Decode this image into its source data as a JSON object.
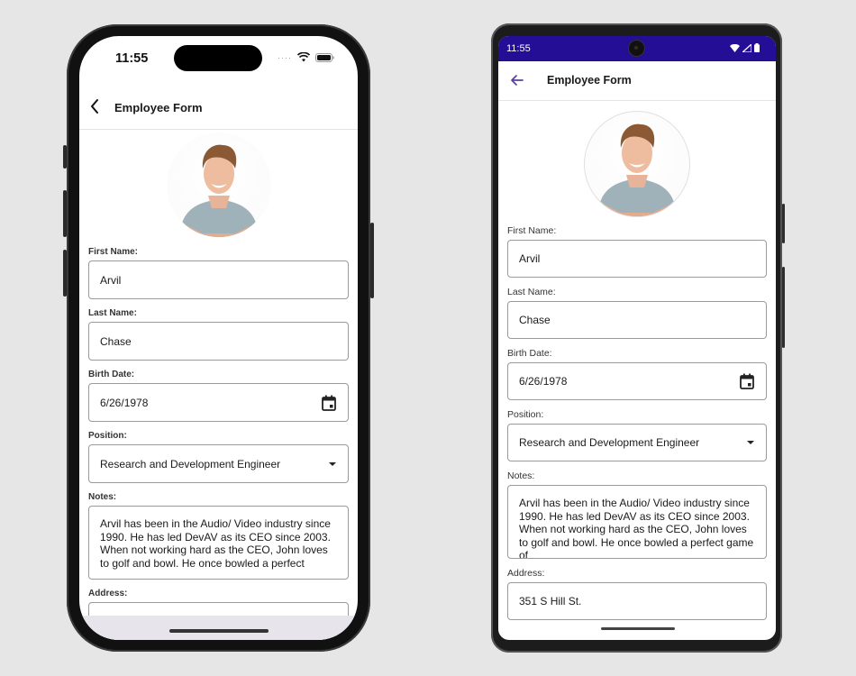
{
  "ios": {
    "status_time": "11:55",
    "nav_title": "Employee Form",
    "back_icon": "chevron-left-icon"
  },
  "android": {
    "status_time": "11:55",
    "nav_title": "Employee Form",
    "back_icon": "arrow-left-icon",
    "status_bar_color": "#240e96",
    "accent_color": "#5b3fa0"
  },
  "form": {
    "avatar_alt": "Employee photo",
    "first_name_label": "First Name:",
    "first_name": "Arvil",
    "last_name_label": "Last Name:",
    "last_name": "Chase",
    "birth_date_label": "Birth Date:",
    "birth_date": "6/26/1978",
    "position_label": "Position:",
    "position": "Research and Development Engineer",
    "notes_label": "Notes:",
    "notes_ios": "Arvil has been in the Audio/ Video industry since 1990. He has led DevAV as its CEO since 2003. When not working hard as the CEO, John loves to golf and bowl. He once bowled a perfect",
    "notes_android": "Arvil has been in the Audio/ Video industry since 1990. He has led DevAV as its CEO since 2003. When not working hard as the CEO, John loves to golf and bowl. He once bowled a perfect game of",
    "address_label": "Address:",
    "address": "351 S Hill St."
  }
}
